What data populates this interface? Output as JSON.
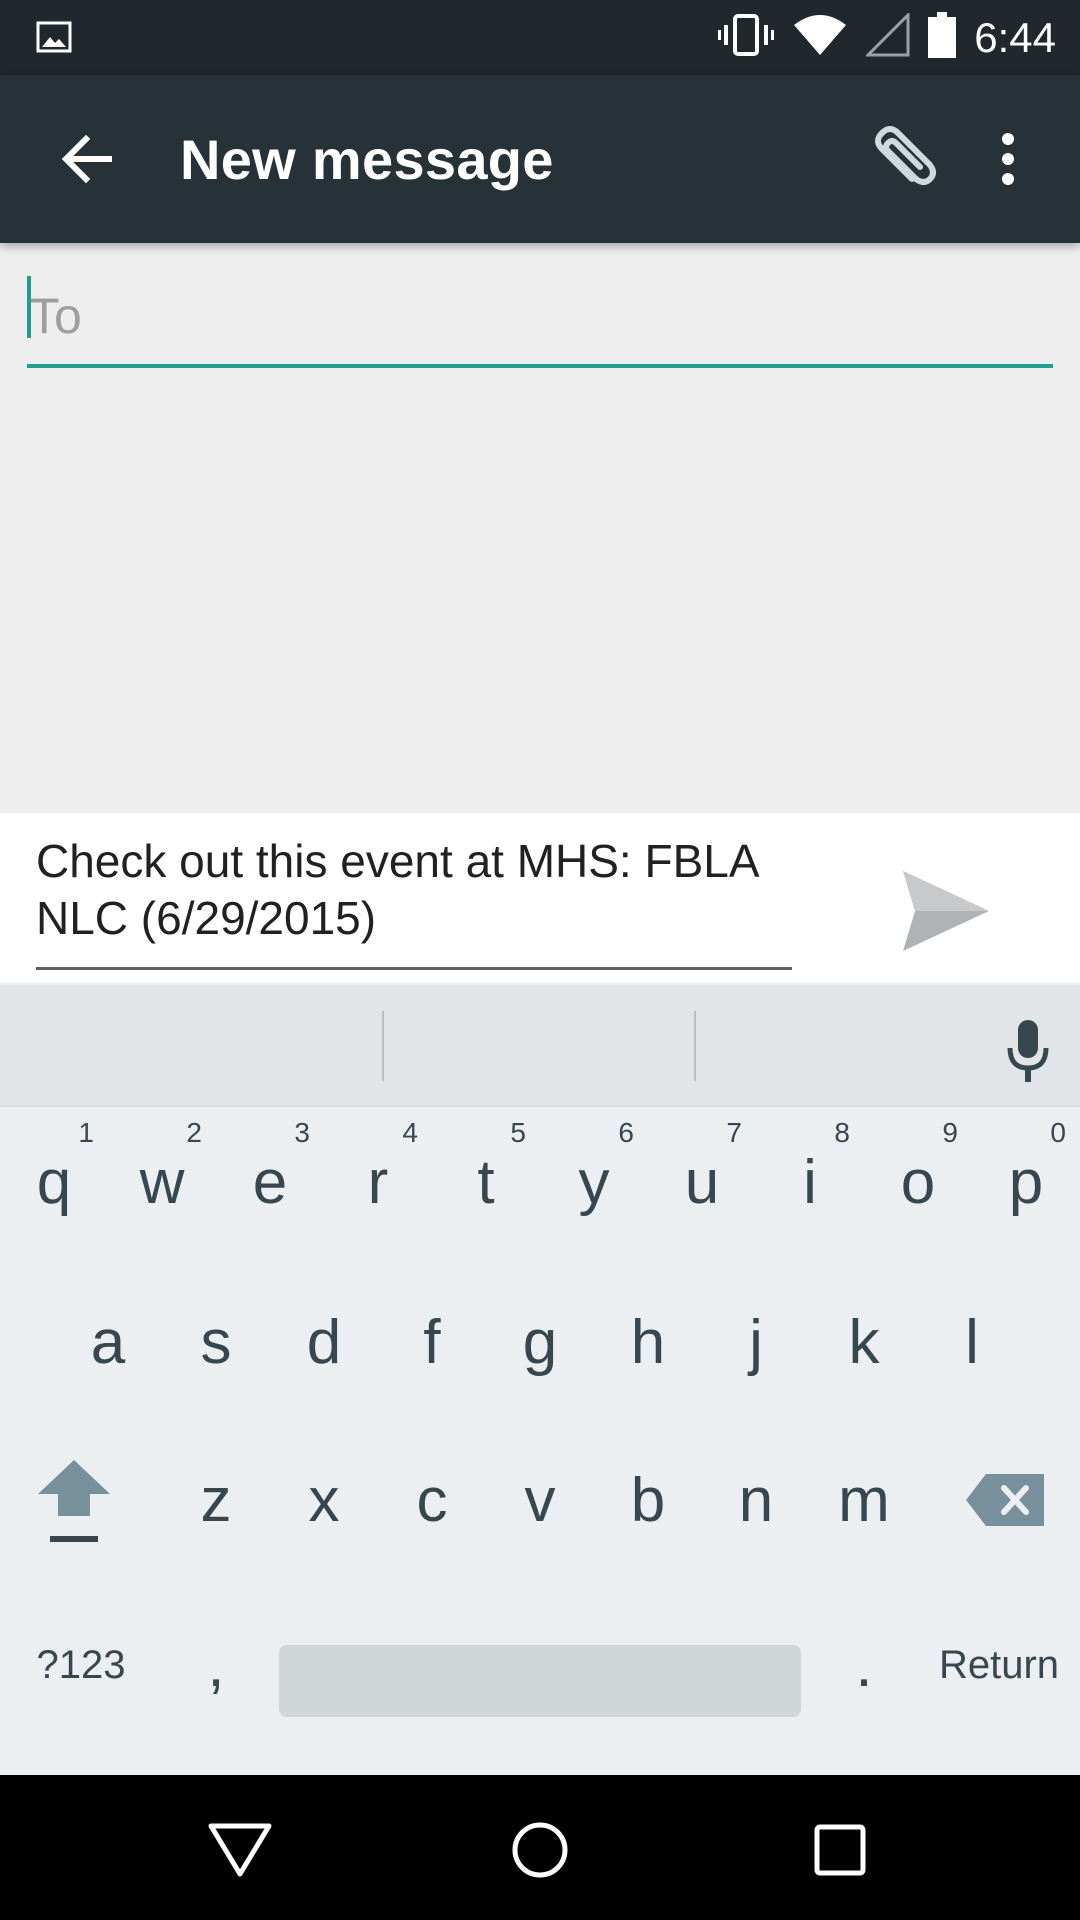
{
  "status_bar": {
    "time": "6:44",
    "icons": [
      "image-notification-icon",
      "vibrate-icon",
      "wifi-icon",
      "cell-signal-icon",
      "battery-icon"
    ]
  },
  "app_bar": {
    "title": "New message",
    "back_icon": "arrow-back-icon",
    "attach_icon": "paperclip-icon",
    "overflow_icon": "more-vert-icon"
  },
  "to_field": {
    "placeholder": "To",
    "value": ""
  },
  "compose": {
    "message": "Check out this event at MHS: FBLA NLC (6/29/2015)",
    "send_icon": "send-icon"
  },
  "keyboard": {
    "row1": [
      {
        "label": "q",
        "hint": "1"
      },
      {
        "label": "w",
        "hint": "2"
      },
      {
        "label": "e",
        "hint": "3"
      },
      {
        "label": "r",
        "hint": "4"
      },
      {
        "label": "t",
        "hint": "5"
      },
      {
        "label": "y",
        "hint": "6"
      },
      {
        "label": "u",
        "hint": "7"
      },
      {
        "label": "i",
        "hint": "8"
      },
      {
        "label": "o",
        "hint": "9"
      },
      {
        "label": "p",
        "hint": "0"
      }
    ],
    "row2": [
      "a",
      "s",
      "d",
      "f",
      "g",
      "h",
      "j",
      "k",
      "l"
    ],
    "row3": [
      "z",
      "x",
      "c",
      "v",
      "b",
      "n",
      "m"
    ],
    "symbols_label": "?123",
    "comma_label": ",",
    "period_label": ".",
    "return_label": "Return",
    "colors": {
      "background": "#eceff1",
      "key_text": "#37474f",
      "accent": "#1f9e8f"
    }
  },
  "nav_bar": {
    "icons": [
      "nav-back-icon",
      "nav-home-icon",
      "nav-recents-icon"
    ]
  }
}
